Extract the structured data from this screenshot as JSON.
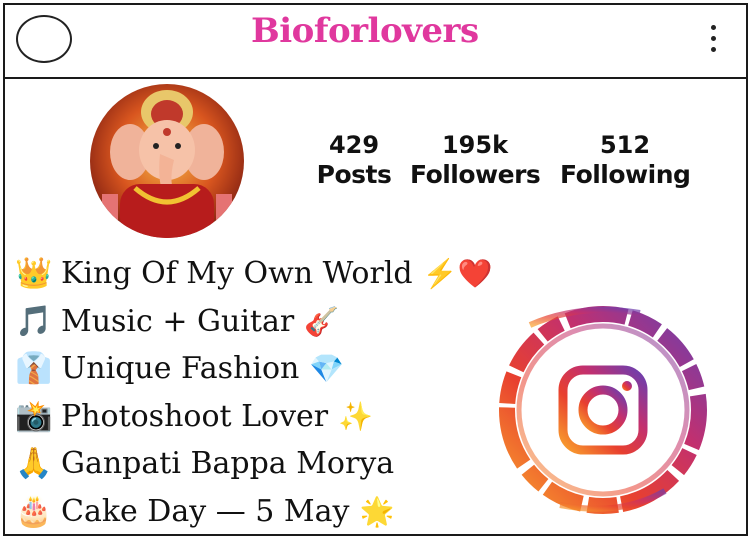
{
  "header": {
    "title": "Bioforlovers",
    "avatar_icon": "circle-outline-icon",
    "menu_icon": "more-vertical-icon"
  },
  "profile": {
    "avatar_icon": "ganesha-portrait-icon",
    "stats": [
      {
        "value": "429",
        "label": "Posts"
      },
      {
        "value": "195k",
        "label": "Followers"
      },
      {
        "value": "512",
        "label": "Following"
      }
    ]
  },
  "bio": [
    {
      "lead": "👑",
      "text": "King Of My Own World",
      "trail": "⚡❤️"
    },
    {
      "lead": "🎵",
      "text": "Music + Guitar",
      "trail": "🎸"
    },
    {
      "lead": "👔",
      "text": "Unique Fashion",
      "trail": "💎"
    },
    {
      "lead": "📸",
      "text": "Photoshoot Lover",
      "trail": "✨"
    },
    {
      "lead": "🙏",
      "text": "Ganpati Bappa Morya",
      "trail": ""
    },
    {
      "lead": "🎂",
      "text": "Cake Day — 5 May",
      "trail": "🌟"
    }
  ],
  "decoration": {
    "logo_icon": "instagram-logo-icon"
  },
  "colors": {
    "brand": "#e0389e",
    "border": "#1a1a1a",
    "text": "#111111"
  }
}
